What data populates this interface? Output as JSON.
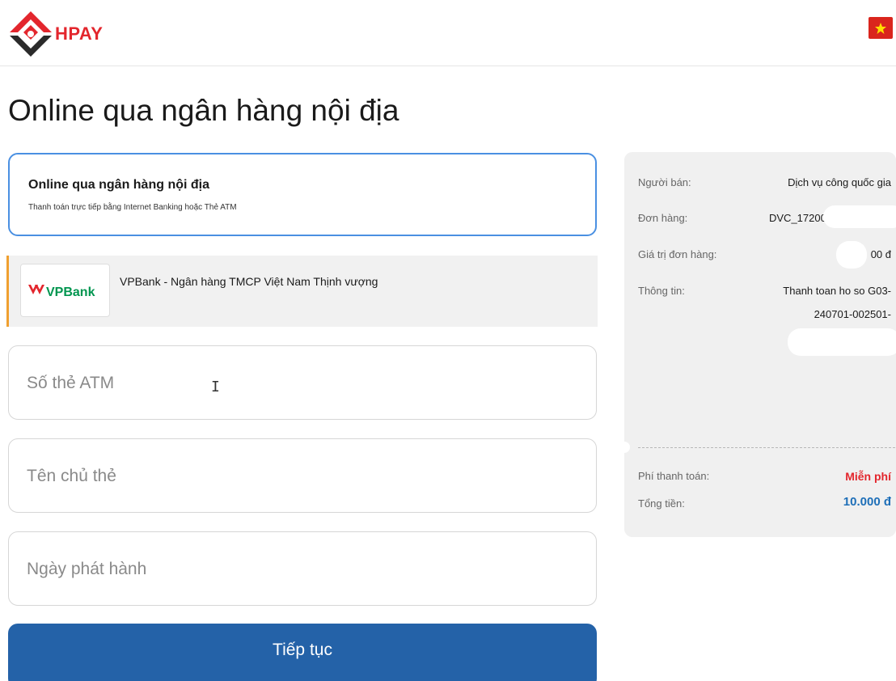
{
  "brand": {
    "name": "HPAY",
    "color": "#e3262d"
  },
  "header": {
    "flag_icon": "vietnam-flag-icon"
  },
  "page_title": "Online qua ngân hàng nội địa",
  "method": {
    "title": "Online qua ngân hàng nội địa",
    "description": "Thanh toán trực tiếp bằng Internet Banking hoặc Thẻ ATM"
  },
  "bank": {
    "logo_text": "VPBank",
    "name": "VPBank - Ngân hàng TMCP Việt Nam Thịnh vượng"
  },
  "form": {
    "card_number_placeholder": "Số thẻ ATM",
    "card_holder_placeholder": "Tên chủ thẻ",
    "issue_date_placeholder": "Ngày phát hành",
    "submit_label": "Tiếp tục"
  },
  "summary": {
    "seller_label": "Người bán:",
    "seller_value": "Dịch vụ công quốc gia",
    "order_label": "Đơn hàng:",
    "order_value": "DVC_172000",
    "amount_label": "Giá trị đơn hàng:",
    "amount_value": "00 đ",
    "info_label": "Thông tin:",
    "info_value_line1": "Thanh toan ho so G03-",
    "info_value_line2": "240701-002501-",
    "fee_label": "Phí thanh toán:",
    "fee_value": "Miễn phí",
    "total_label": "Tổng tiền:",
    "total_value": "10.000 đ"
  },
  "colors": {
    "accent_blue": "#2462a8",
    "selected_border": "#4a90e2",
    "fee_red": "#e3262d",
    "total_blue": "#1e6fb8"
  }
}
